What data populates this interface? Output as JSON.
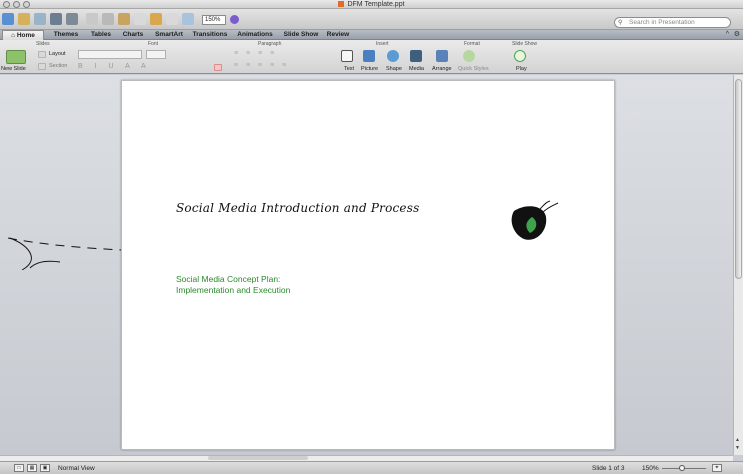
{
  "window": {
    "title": "DFM Template.ppt"
  },
  "toolbar": {
    "zoom_value": "150%",
    "search_placeholder": "Search in Presentation"
  },
  "tabs": [
    {
      "label": "Home"
    },
    {
      "label": "Themes"
    },
    {
      "label": "Tables"
    },
    {
      "label": "Charts"
    },
    {
      "label": "SmartArt"
    },
    {
      "label": "Transitions"
    },
    {
      "label": "Animations"
    },
    {
      "label": "Slide Show"
    },
    {
      "label": "Review"
    }
  ],
  "ribbon": {
    "groups": {
      "slides": "Slides",
      "font": "Font",
      "paragraph": "Paragraph",
      "insert": "Insert",
      "format": "Format",
      "slide_show": "Slide Show"
    },
    "new_slide": "New Slide",
    "layout": "Layout",
    "section": "Section",
    "text": "Text",
    "picture": "Picture",
    "shape": "Shape",
    "media": "Media",
    "arrange": "Arrange",
    "quick_styles": "Quick Styles",
    "play": "Play"
  },
  "slide": {
    "title": "Social Media Introduction and Process",
    "subtitle_line1": "Social Media Concept Plan:",
    "subtitle_line2": "Implementation and Execution"
  },
  "statusbar": {
    "view": "Normal View",
    "slide_counter": "Slide 1 of 3",
    "zoom": "150%"
  },
  "colors": {
    "accent_green": "#2a8a2a",
    "leaf_green": "#3fa34d"
  }
}
